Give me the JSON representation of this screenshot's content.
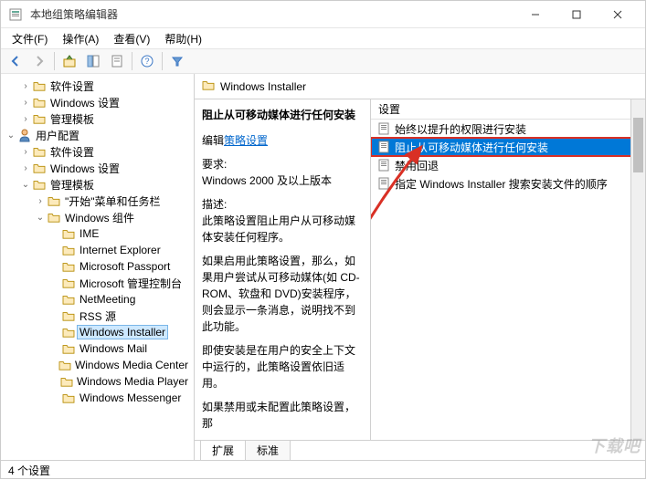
{
  "window": {
    "title": "本地组策略编辑器"
  },
  "menu": {
    "file": "文件(F)",
    "action": "操作(A)",
    "view": "查看(V)",
    "help": "帮助(H)"
  },
  "tree": {
    "items": [
      {
        "indent": 1,
        "expander": "›",
        "icon": "folder",
        "label": "软件设置"
      },
      {
        "indent": 1,
        "expander": "›",
        "icon": "folder",
        "label": "Windows 设置"
      },
      {
        "indent": 1,
        "expander": "›",
        "icon": "folder",
        "label": "管理模板"
      },
      {
        "indent": 0,
        "expander": "⌄",
        "icon": "user",
        "label": "用户配置"
      },
      {
        "indent": 1,
        "expander": "›",
        "icon": "folder",
        "label": "软件设置"
      },
      {
        "indent": 1,
        "expander": "›",
        "icon": "folder",
        "label": "Windows 设置"
      },
      {
        "indent": 1,
        "expander": "⌄",
        "icon": "folder",
        "label": "管理模板"
      },
      {
        "indent": 2,
        "expander": "›",
        "icon": "folder",
        "label": "\"开始\"菜单和任务栏"
      },
      {
        "indent": 2,
        "expander": "⌄",
        "icon": "folder",
        "label": "Windows 组件"
      },
      {
        "indent": 3,
        "expander": "",
        "icon": "folder",
        "label": "IME"
      },
      {
        "indent": 3,
        "expander": "",
        "icon": "folder",
        "label": "Internet Explorer"
      },
      {
        "indent": 3,
        "expander": "",
        "icon": "folder",
        "label": "Microsoft Passport"
      },
      {
        "indent": 3,
        "expander": "",
        "icon": "folder",
        "label": "Microsoft 管理控制台"
      },
      {
        "indent": 3,
        "expander": "",
        "icon": "folder",
        "label": "NetMeeting"
      },
      {
        "indent": 3,
        "expander": "",
        "icon": "folder",
        "label": "RSS 源"
      },
      {
        "indent": 3,
        "expander": "",
        "icon": "folder",
        "label": "Windows Installer",
        "selected": true
      },
      {
        "indent": 3,
        "expander": "",
        "icon": "folder",
        "label": "Windows Mail"
      },
      {
        "indent": 3,
        "expander": "",
        "icon": "folder",
        "label": "Windows Media Center"
      },
      {
        "indent": 3,
        "expander": "",
        "icon": "folder",
        "label": "Windows Media Player"
      },
      {
        "indent": 3,
        "expander": "",
        "icon": "folder",
        "label": "Windows Messenger"
      }
    ]
  },
  "right": {
    "header": "Windows Installer",
    "detail": {
      "title": "阻止从可移动媒体进行任何安装",
      "edit_label": "编辑",
      "edit_link": "策略设置",
      "req_label": "要求:",
      "req_value": "Windows 2000 及以上版本",
      "desc_label": "描述:",
      "desc_p1": "此策略设置阻止用户从可移动媒体安装任何程序。",
      "desc_p2": "如果启用此策略设置，那么，如果用户尝试从可移动媒体(如 CD-ROM、软盘和 DVD)安装程序，则会显示一条消息，说明找不到此功能。",
      "desc_p3": "即使安装是在用户的安全上下文中运行的，此策略设置依旧适用。",
      "desc_p4": "如果禁用或未配置此策略设置，那"
    },
    "settings_header": "设置",
    "settings": [
      {
        "label": "始终以提升的权限进行安装"
      },
      {
        "label": "阻止从可移动媒体进行任何安装",
        "selected": true,
        "highlighted": true
      },
      {
        "label": "禁用回退"
      },
      {
        "label": "指定 Windows Installer 搜索安装文件的顺序"
      }
    ],
    "tabs": {
      "extended": "扩展",
      "standard": "标准"
    }
  },
  "status": {
    "text": "4 个设置"
  },
  "watermark": "下载吧"
}
